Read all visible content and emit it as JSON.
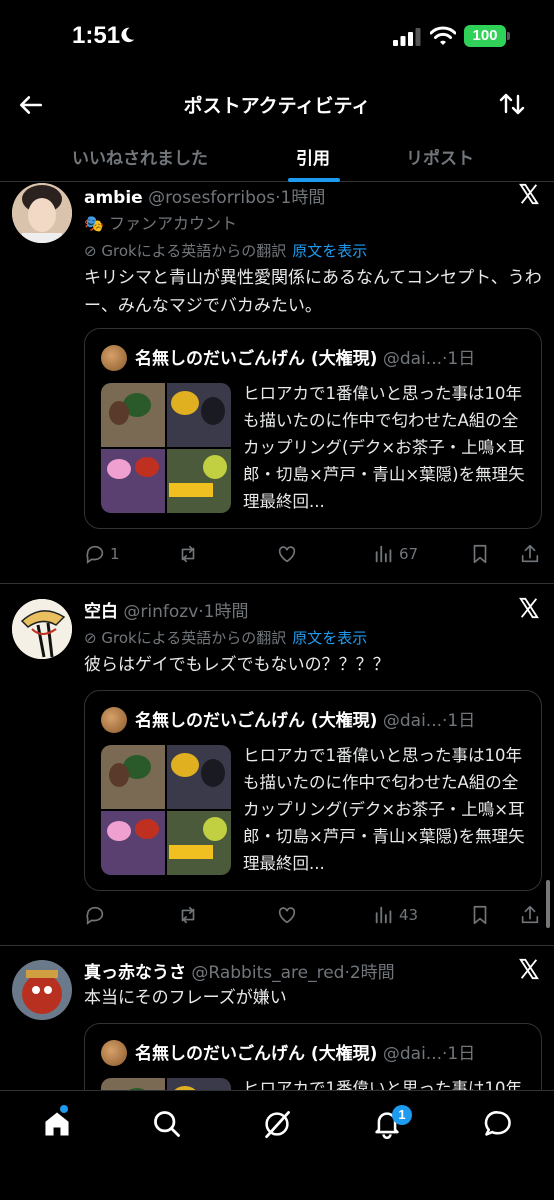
{
  "status": {
    "time": "1:51",
    "battery": "100"
  },
  "header": {
    "title": "ポストアクティビティ"
  },
  "tabs": [
    {
      "label": "いいねされました",
      "active": false
    },
    {
      "label": "引用",
      "active": true
    },
    {
      "label": "リポスト",
      "active": false
    }
  ],
  "quoted_post": {
    "author": "名無しのだいごんげん (大権現)",
    "handle": "@dai...",
    "time": "·1日",
    "text": "ヒロアカで1番偉いと思った事は10年も描いたのに作中で匂わせたA組の全カップリング(デク×お茶子・上鳴×耳郎・切島×芦戸・青山×葉隠)を無理矢理最終回..."
  },
  "posts": [
    {
      "name": "ambie",
      "handle": "@rosesforribos",
      "time": "·1時間",
      "subline": "ファンアカウント",
      "translate_label": "Grokによる英語からの翻訳",
      "translate_link": "原文を表示",
      "text": "キリシマと青山が異性愛関係にあるなんてコンセプト、うわー、みんなマジでバカみたい。",
      "replies": "1",
      "views": "67"
    },
    {
      "name": "空白",
      "handle": "@rinfozv",
      "time": "·1時間",
      "translate_label": "Grokによる英語からの翻訳",
      "translate_link": "原文を表示",
      "text": "彼らはゲイでもレズでもないの？？？？",
      "replies": "",
      "views": "43"
    },
    {
      "name": "真っ赤なうさ",
      "handle": "@Rabbits_are_red",
      "time": "·2時間",
      "text": "本当にそのフレーズが嫌い"
    }
  ],
  "nav": {
    "notifications_badge": "1"
  },
  "colors": {
    "accent": "#1d9bf0",
    "muted": "#71767b",
    "divider": "#2f3336",
    "battery": "#30d158"
  },
  "icons": [
    "back-arrow-icon",
    "sort-icon",
    "x-logo-icon",
    "reply-icon",
    "repost-icon",
    "like-icon",
    "views-icon",
    "bookmark-icon",
    "share-icon",
    "home-icon",
    "search-icon",
    "grok-icon",
    "bell-icon",
    "messages-icon"
  ]
}
